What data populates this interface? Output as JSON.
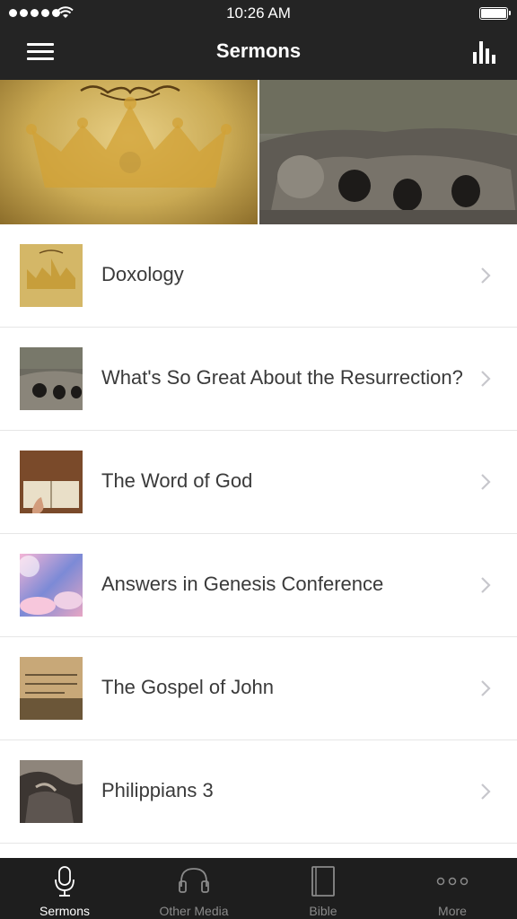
{
  "status_bar": {
    "time": "10:26 AM"
  },
  "nav": {
    "title": "Sermons"
  },
  "sermons": [
    {
      "title": "Doxology",
      "thumb": "crown-thumbnail"
    },
    {
      "title": "What's So Great About the Resurrection?",
      "thumb": "tomb-thumbnail"
    },
    {
      "title": "The Word of God",
      "thumb": "bible-reading-thumbnail"
    },
    {
      "title": "Answers in Genesis Conference",
      "thumb": "sky-thumbnail"
    },
    {
      "title": "The Gospel of John",
      "thumb": "scripture-page-thumbnail"
    },
    {
      "title": "Philippians 3",
      "thumb": "hands-thumbnail"
    }
  ],
  "tabs": [
    {
      "label": "Sermons",
      "icon": "microphone-icon",
      "active": true
    },
    {
      "label": "Other Media",
      "icon": "headphones-icon",
      "active": false
    },
    {
      "label": "Bible",
      "icon": "book-icon",
      "active": false
    },
    {
      "label": "More",
      "icon": "more-icon",
      "active": false
    }
  ],
  "colors": {
    "header_bg": "#242424",
    "tabbar_bg": "#1e1e1e",
    "active_tab": "#ffffff",
    "inactive_tab": "#8a8a8a"
  }
}
